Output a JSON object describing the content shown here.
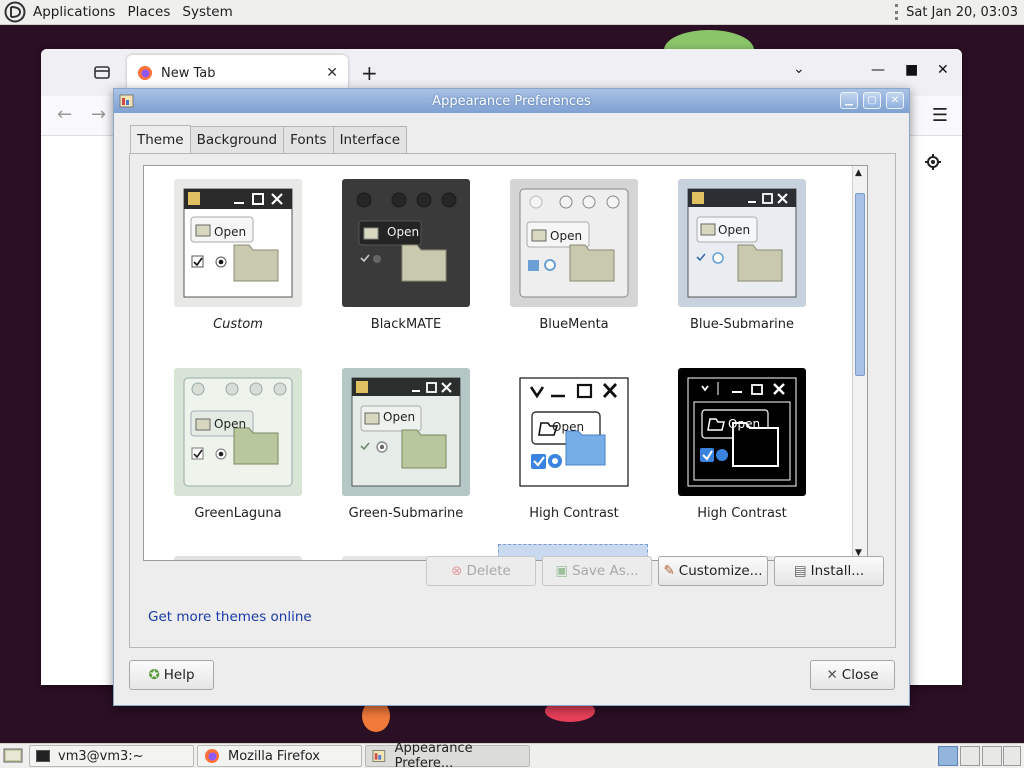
{
  "top_panel": {
    "menus": [
      "Applications",
      "Places",
      "System"
    ],
    "clock": "Sat Jan 20, 03:03"
  },
  "firefox": {
    "tab_title": "New Tab"
  },
  "dialog": {
    "title": "Appearance Preferences",
    "tabs": [
      "Theme",
      "Background",
      "Fonts",
      "Interface"
    ],
    "active_tab": "Theme",
    "themes": [
      {
        "name": "Custom",
        "selected": false
      },
      {
        "name": "BlackMATE",
        "selected": false
      },
      {
        "name": "BlueMenta",
        "selected": false
      },
      {
        "name": "Blue-Submarine",
        "selected": false
      },
      {
        "name": "GreenLaguna",
        "selected": false
      },
      {
        "name": "Green-Submarine",
        "selected": false
      },
      {
        "name": "High Contrast",
        "selected": false
      },
      {
        "name": "High Contrast",
        "selected": false
      }
    ],
    "thumb_open_label": "Open",
    "buttons": {
      "delete": "Delete",
      "save_as": "Save As...",
      "customize": "Customize...",
      "install": "Install..."
    },
    "more_themes_link": "Get more themes online",
    "help": "Help",
    "close": "Close"
  },
  "taskbar": {
    "tasks": [
      "vm3@vm3:~",
      "Mozilla Firefox",
      "Appearance Prefere..."
    ]
  },
  "colors": {
    "accent": "#7fa0d2",
    "link": "#1a3aa8",
    "desktop": "#2b0f24"
  }
}
